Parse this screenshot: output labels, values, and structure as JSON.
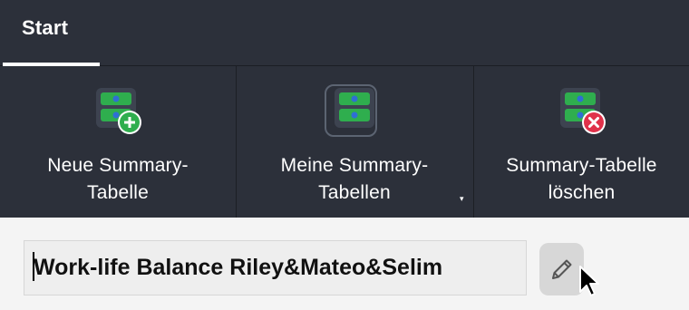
{
  "ribbon": {
    "tabs": [
      {
        "label": "Start",
        "active": true
      }
    ],
    "buttons": [
      {
        "id": "new",
        "label_line1": "Neue Summary-",
        "label_line2": "Tabelle",
        "icon": "summary-table-add-icon"
      },
      {
        "id": "mine",
        "label_line1": "Meine Summary-",
        "label_line2": "Tabellen",
        "icon": "summary-table-icon",
        "has_dropdown": true
      },
      {
        "id": "delete",
        "label_line1": "Summary-Tabelle",
        "label_line2": "löschen",
        "icon": "summary-table-delete-icon"
      }
    ],
    "dropdown_caret": "▾"
  },
  "table_name": {
    "value": "Work-life Balance Riley&Mateo&Selim",
    "edit_icon": "pencil-icon"
  },
  "colors": {
    "ribbon_bg": "#2c303a",
    "green": "#2fae4e",
    "blue": "#2f6fd3",
    "red": "#e0314a"
  }
}
